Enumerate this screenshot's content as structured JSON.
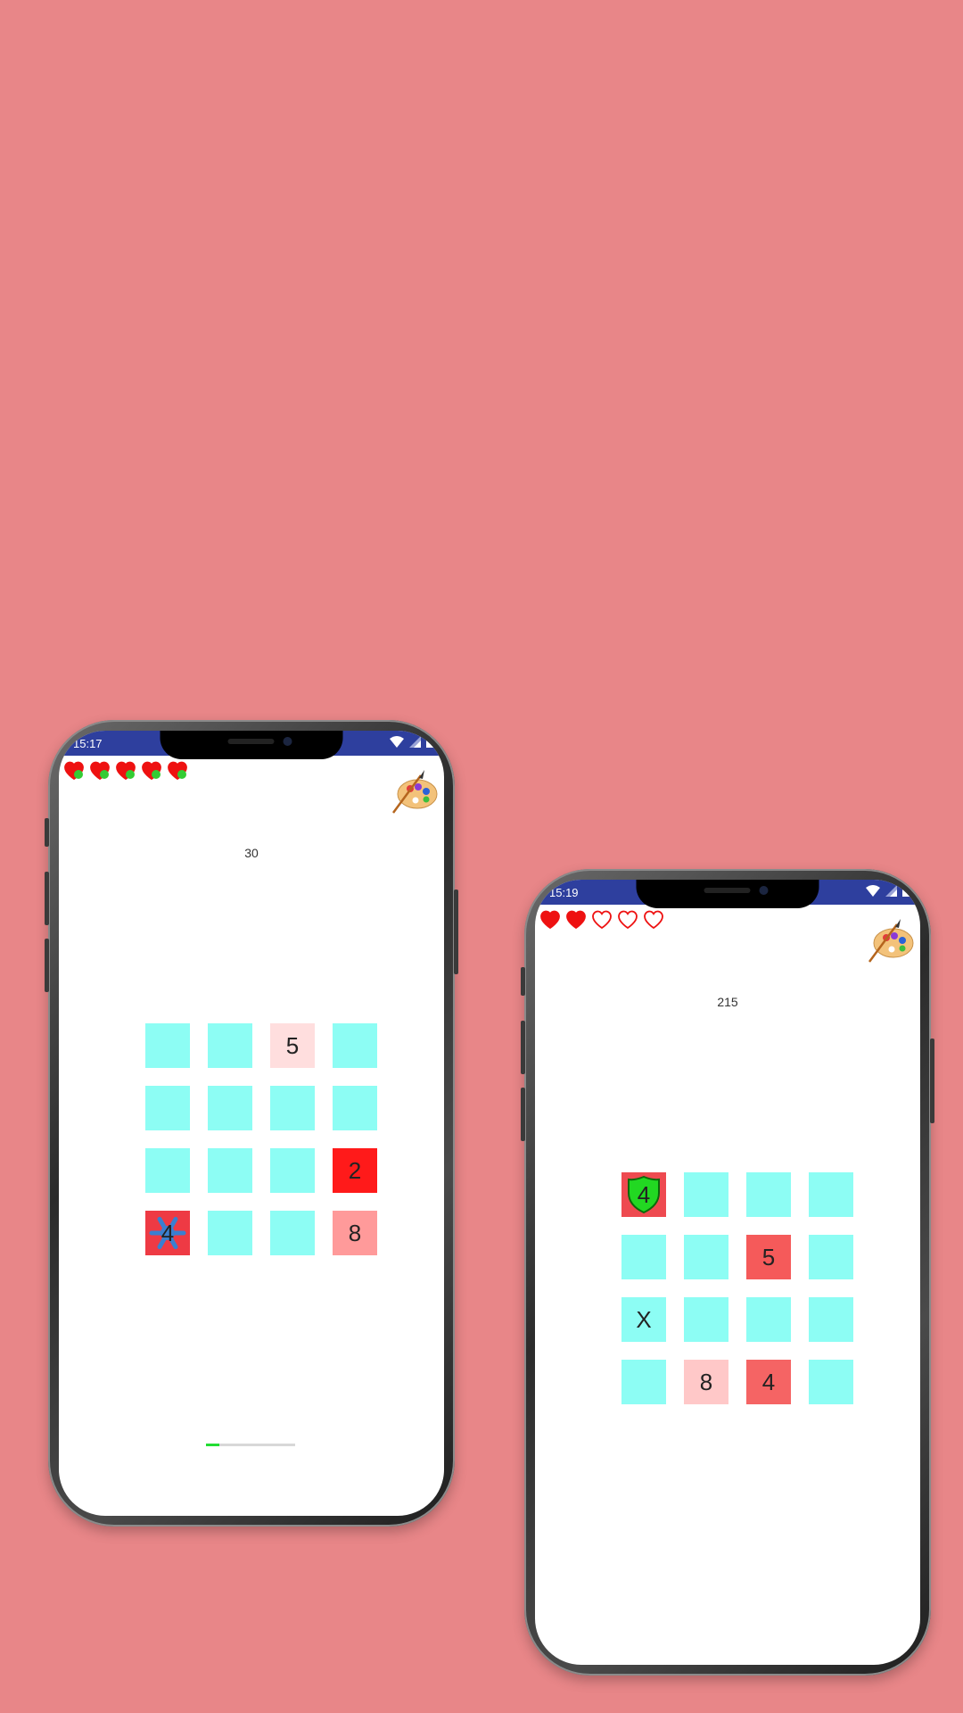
{
  "colors": {
    "background": "#e88688",
    "statusbar": "#2e3f9e",
    "tile_hidden": "#8dfdf4",
    "heart_red": "#ee1111",
    "plus_green": "#33cc33",
    "progress_fill": "#22dd33"
  },
  "phones": [
    {
      "status_time": "15:17",
      "lives": {
        "total": 5,
        "filled": 5,
        "style": "heart-plus-icon"
      },
      "score": "30",
      "progress": 0.15,
      "grid": [
        [
          {
            "label": "",
            "color": "#8dfdf4"
          },
          {
            "label": "",
            "color": "#8dfdf4"
          },
          {
            "label": "5",
            "color": "#ffdede"
          },
          {
            "label": "",
            "color": "#8dfdf4"
          }
        ],
        [
          {
            "label": "",
            "color": "#8dfdf4"
          },
          {
            "label": "",
            "color": "#8dfdf4"
          },
          {
            "label": "",
            "color": "#8dfdf4"
          },
          {
            "label": "",
            "color": "#8dfdf4"
          }
        ],
        [
          {
            "label": "",
            "color": "#8dfdf4"
          },
          {
            "label": "",
            "color": "#8dfdf4"
          },
          {
            "label": "",
            "color": "#8dfdf4"
          },
          {
            "label": "2",
            "color": "#ff1a1a"
          }
        ],
        [
          {
            "label": "4",
            "color": "#ee3a44",
            "icon": "snowflake-icon"
          },
          {
            "label": "",
            "color": "#8dfdf4"
          },
          {
            "label": "",
            "color": "#8dfdf4"
          },
          {
            "label": "8",
            "color": "#ff9a9a"
          }
        ]
      ]
    },
    {
      "status_time": "15:19",
      "lives": {
        "total": 5,
        "filled": 2,
        "style": "heart-icon"
      },
      "score": "215",
      "grid": [
        [
          {
            "label": "4",
            "color": "#ee4a50",
            "icon": "shield-icon"
          },
          {
            "label": "",
            "color": "#8dfdf4"
          },
          {
            "label": "",
            "color": "#8dfdf4"
          },
          {
            "label": "",
            "color": "#8dfdf4"
          }
        ],
        [
          {
            "label": "",
            "color": "#8dfdf4"
          },
          {
            "label": "",
            "color": "#8dfdf4"
          },
          {
            "label": "5",
            "color": "#f55a5a"
          },
          {
            "label": "",
            "color": "#8dfdf4"
          }
        ],
        [
          {
            "label": "X",
            "color": "#8dfdf4"
          },
          {
            "label": "",
            "color": "#8dfdf4"
          },
          {
            "label": "",
            "color": "#8dfdf4"
          },
          {
            "label": "",
            "color": "#8dfdf4"
          }
        ],
        [
          {
            "label": "",
            "color": "#8dfdf4"
          },
          {
            "label": "8",
            "color": "#ffc8c8"
          },
          {
            "label": "4",
            "color": "#f56464"
          },
          {
            "label": "",
            "color": "#8dfdf4"
          }
        ]
      ]
    }
  ],
  "icons": [
    "wifi-icon",
    "signal-icon",
    "battery-icon",
    "palette-icon"
  ]
}
